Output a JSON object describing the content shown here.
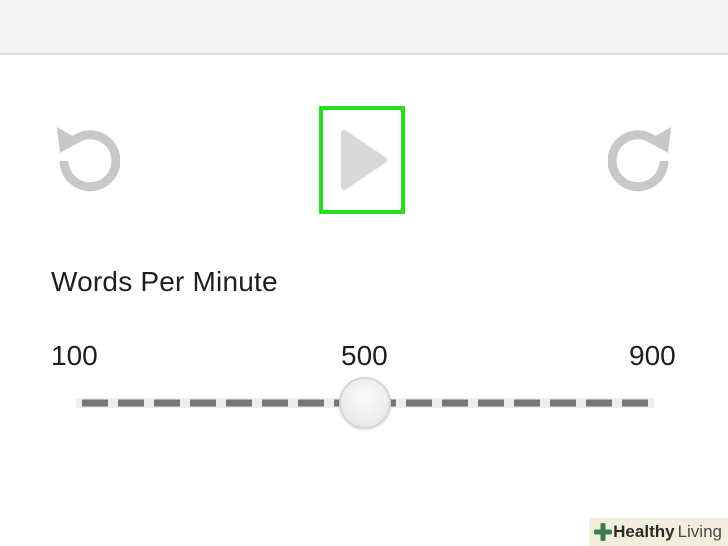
{
  "controls": {
    "rewind_icon": "rotate-ccw-icon",
    "play_icon": "play-icon",
    "forward_icon": "rotate-cw-icon",
    "highlight_color": "#1de21d",
    "icon_color": "#c8c8c8",
    "play_color": "#d8d8d8"
  },
  "speed": {
    "label": "Words Per Minute",
    "min_label": "100",
    "mid_label": "500",
    "max_label": "900",
    "min": 100,
    "max": 900,
    "value": 500
  },
  "watermark": {
    "logo_icon": "plus-icon",
    "bold": "Healthy",
    "light": "Living"
  }
}
